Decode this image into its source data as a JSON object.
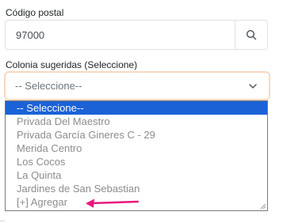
{
  "postal": {
    "label": "Código postal",
    "value": "97000",
    "search_icon": "search-icon"
  },
  "colonia": {
    "label": "Colonia sugeridas (Seleccione)",
    "selected": "-- Seleccione--",
    "chevron_icon": "chevron-down-icon",
    "options": [
      "-- Seleccione--",
      "Privada Del Maestro",
      "Privada García Gineres C - 29",
      "Merida Centro",
      "Los Cocos",
      "La Quinta",
      "Jardines de San Sebastian",
      "[+] Agregar"
    ]
  },
  "colors": {
    "highlight": "#1a62d6",
    "arrow": "#e8187e",
    "focus_border": "#f6d9c2"
  },
  "annotation": {
    "arrow_icon": "arrow-left-icon"
  }
}
